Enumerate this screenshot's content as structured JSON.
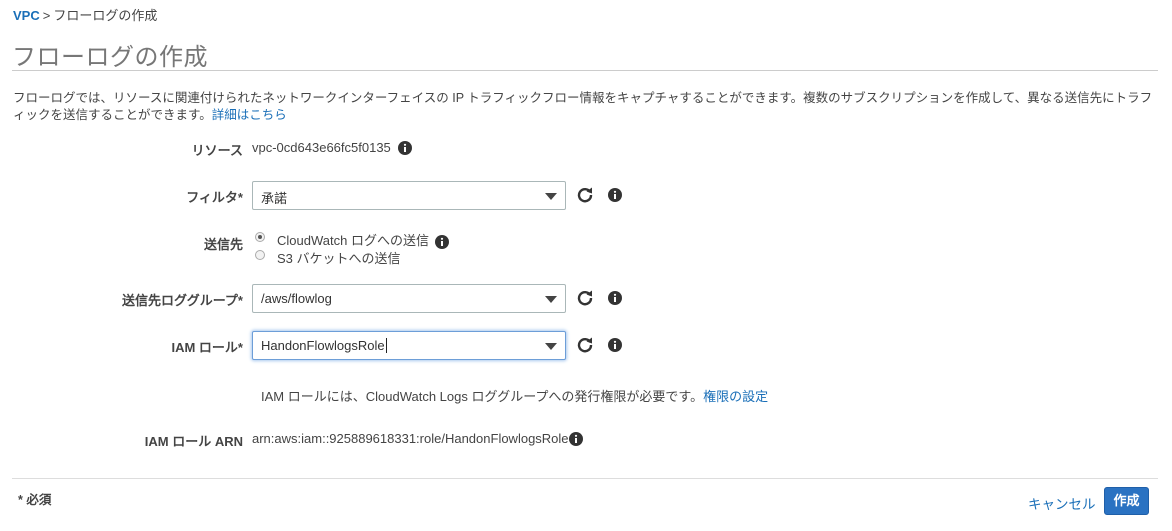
{
  "breadcrumb": {
    "root": "VPC",
    "separator": ">",
    "current": "フローログの作成"
  },
  "page": {
    "title": "フローログの作成",
    "description": "フローログでは、リソースに関連付けられたネットワークインターフェイスの IP トラフィックフロー情報をキャプチャすることができます。複数のサブスクリプションを作成して、異なる送信先にトラフィックを送信することができます。",
    "details_link": "詳細はこちら"
  },
  "form": {
    "resource": {
      "label": "リソース",
      "value": "vpc-0cd643e66fc5f0135",
      "icon": "info-icon"
    },
    "filter": {
      "label": "フィルタ*",
      "value": "承諾",
      "icon": "info-icon"
    },
    "destination": {
      "label": "送信先",
      "options": [
        "CloudWatch ログへの送信",
        "S3 バケットへの送信"
      ],
      "selected": "CloudWatch ログへの送信",
      "icon": "info-icon"
    },
    "log_group": {
      "label": "送信先ロググループ*",
      "value": "/aws/flowlog"
    },
    "iam_role": {
      "label": "IAM ロール*",
      "value": "HandonFlowlogsRole"
    },
    "iam_hint": {
      "text": "IAM ロールには、CloudWatch Logs ロググループへの発行権限が必要です。",
      "link": "権限の設定"
    },
    "iam_role_arn": {
      "label": "IAM ロール ARN",
      "value": "arn:aws:iam::925889618331:role/HandonFlowlogsRole"
    }
  },
  "footer": {
    "required_note": "* 必須",
    "cancel_label": "キャンセル",
    "create_label": "作成"
  },
  "colors": {
    "link": "#1a6fb8",
    "primary_button": "#2a72c2",
    "title": "#777777",
    "text": "#444444",
    "focus_border": "#6d9ed8"
  }
}
